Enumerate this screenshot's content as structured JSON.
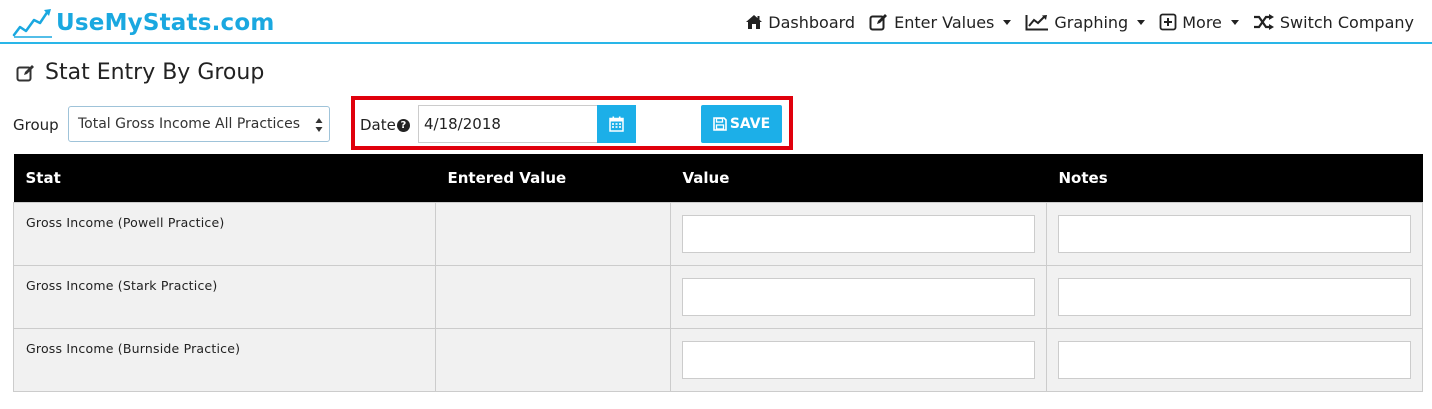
{
  "brand": {
    "name": "UseMyStats.com",
    "color": "#1aa8e0",
    "icon": "chart-line-logo-icon"
  },
  "nav": {
    "items": [
      {
        "label": "Dashboard",
        "icon": "home-icon",
        "dropdown": false
      },
      {
        "label": "Enter Values",
        "icon": "edit-icon",
        "dropdown": true
      },
      {
        "label": "Graphing",
        "icon": "line-chart-icon",
        "dropdown": true
      },
      {
        "label": "More",
        "icon": "plus-square-icon",
        "dropdown": true
      },
      {
        "label": "Switch Company",
        "icon": "shuffle-icon",
        "dropdown": false
      }
    ],
    "accent": "#29b6e8"
  },
  "page": {
    "title": "Stat Entry By Group",
    "title_icon": "edit-icon"
  },
  "filters": {
    "group_label": "Group",
    "group_value": "Total Gross Income All Practices",
    "date_label": "Date",
    "date_help_icon": "question-circle-icon",
    "date_value": "4/18/2018",
    "calendar_icon": "calendar-icon",
    "save_label": "SAVE",
    "save_icon": "floppy-disk-icon",
    "button_color": "#1cafe8",
    "highlight_color": "#e0000c"
  },
  "table": {
    "columns": [
      "Stat",
      "Entered Value",
      "Value",
      "Notes"
    ],
    "rows": [
      {
        "stat": "Gross Income (Powell Practice)",
        "entered": "",
        "value": "",
        "notes": ""
      },
      {
        "stat": "Gross Income (Stark Practice)",
        "entered": "",
        "value": "",
        "notes": ""
      },
      {
        "stat": "Gross Income (Burnside Practice)",
        "entered": "",
        "value": "",
        "notes": ""
      }
    ]
  }
}
